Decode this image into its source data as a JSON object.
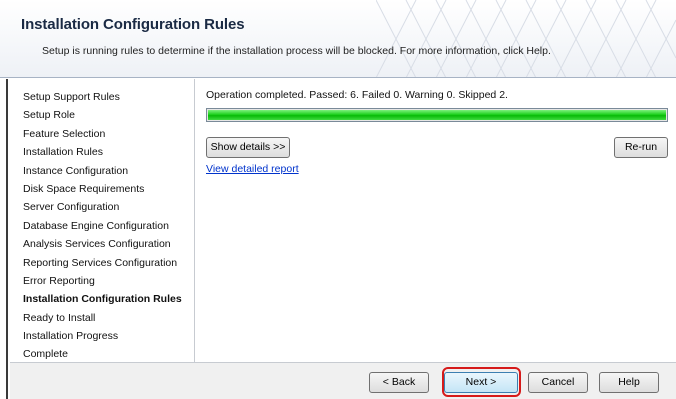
{
  "header": {
    "title": "Installation Configuration Rules",
    "subtitle": "Setup is running rules to determine if the installation process will be blocked. For more information, click Help."
  },
  "sidebar": {
    "items": [
      {
        "label": "Setup Support Rules",
        "active": false
      },
      {
        "label": "Setup Role",
        "active": false
      },
      {
        "label": "Feature Selection",
        "active": false
      },
      {
        "label": "Installation Rules",
        "active": false
      },
      {
        "label": "Instance Configuration",
        "active": false
      },
      {
        "label": "Disk Space Requirements",
        "active": false
      },
      {
        "label": "Server Configuration",
        "active": false
      },
      {
        "label": "Database Engine Configuration",
        "active": false
      },
      {
        "label": "Analysis Services Configuration",
        "active": false
      },
      {
        "label": "Reporting Services Configuration",
        "active": false
      },
      {
        "label": "Error Reporting",
        "active": false
      },
      {
        "label": "Installation Configuration Rules",
        "active": true
      },
      {
        "label": "Ready to Install",
        "active": false
      },
      {
        "label": "Installation Progress",
        "active": false
      },
      {
        "label": "Complete",
        "active": false
      }
    ]
  },
  "main": {
    "status": "Operation completed. Passed: 6.   Failed 0.   Warning 0.   Skipped 2.",
    "progress_percent": 100,
    "progress_color": "#1fd11f",
    "show_details_label": "Show details >>",
    "rerun_label": "Re-run",
    "report_link": "View detailed report"
  },
  "footer": {
    "back_label": "< Back",
    "next_label": "Next >",
    "cancel_label": "Cancel",
    "help_label": "Help",
    "highlight_color": "#d61a1a"
  }
}
